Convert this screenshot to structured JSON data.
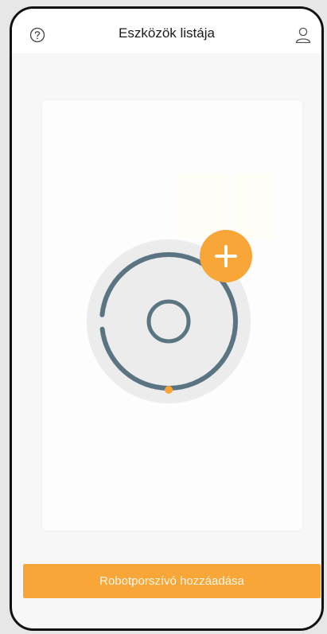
{
  "header": {
    "title": "Eszközök listája",
    "help_icon": "question-circle-icon",
    "user_icon": "user-profile-icon"
  },
  "card": {
    "illustration": "robot-vacuum-illustration",
    "add_icon": "plus-icon"
  },
  "footer": {
    "add_button_label": "Robotporszívó hozzáadása"
  },
  "colors": {
    "accent": "#f7a637",
    "robot_ring": "#5b7482",
    "background": "#f7f7f7"
  }
}
